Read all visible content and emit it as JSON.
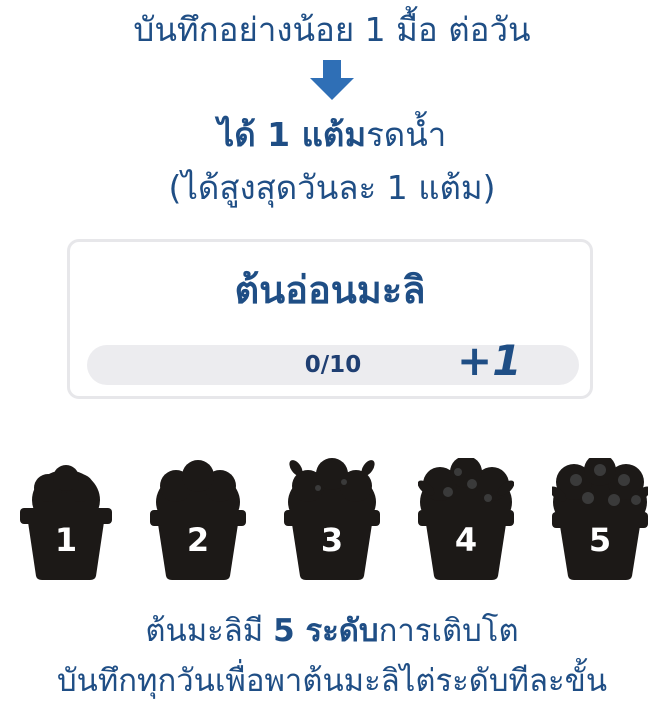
{
  "header": {
    "instruction": "บันทึกอย่างน้อย 1 มื้อ ต่อวัน",
    "arrow_icon": "down-arrow-icon",
    "reward_bold": "ได้ 1 แต้ม",
    "reward_rest": "รดน้ำ",
    "daily_cap": "(ได้สูงสุดวันละ 1 แต้ม)"
  },
  "plant_card": {
    "name": "ต้นอ่อนมะลิ",
    "progress_text": "0/10",
    "progress_fraction": 0.0,
    "plus_label": "+1"
  },
  "levels": [
    {
      "number": "1",
      "icon": "pot-plant-level-1-icon"
    },
    {
      "number": "2",
      "icon": "pot-plant-level-2-icon"
    },
    {
      "number": "3",
      "icon": "pot-plant-level-3-icon"
    },
    {
      "number": "4",
      "icon": "pot-plant-level-4-icon"
    },
    {
      "number": "5",
      "icon": "pot-plant-level-5-icon"
    }
  ],
  "footer": {
    "line1_prefix": "ต้นมะลิมี ",
    "line1_bold": "5 ระดับ",
    "line1_suffix": "การเติบโต",
    "line2": "บันทึกทุกวันเพื่อพาต้นมะลิไต่ระดับทีละขั้น"
  },
  "colors": {
    "text": "#1f4e85",
    "arrow": "#2f6fb6",
    "progress_track": "#ececef",
    "pot": "#1c1917"
  }
}
